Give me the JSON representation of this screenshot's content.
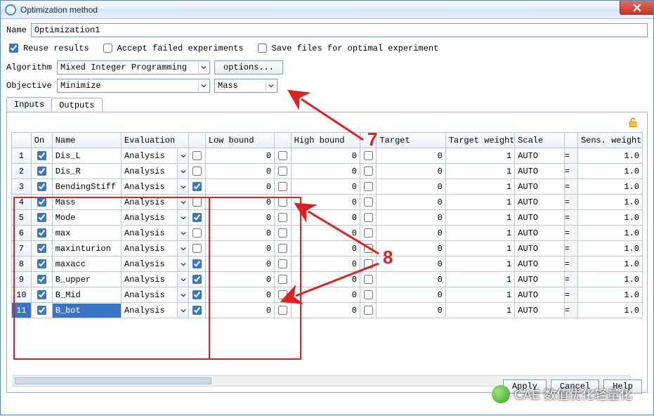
{
  "window": {
    "title": "Optimization method",
    "close_label": "X"
  },
  "fields": {
    "name_label": "Name",
    "name_value": "Optimization1",
    "reuse_label": "Reuse results",
    "reuse_checked": true,
    "accept_label": "Accept failed experiments",
    "accept_checked": false,
    "savefiles_label": "Save files for optimal experiment",
    "savefiles_checked": false,
    "algorithm_label": "Algorithm",
    "algorithm_value": "Mixed Integer Programming",
    "options_label": "options...",
    "objective_label": "Objective",
    "objective_value": "Minimize",
    "objective_target": "Mass"
  },
  "tabs": {
    "inputs": "Inputs",
    "outputs": "Outputs",
    "active": "outputs"
  },
  "columns": {
    "idx": "",
    "on": "On",
    "name": "Name",
    "evaluation": "Evaluation",
    "lowbound": "Low bound",
    "highbound": "High bound",
    "target": "Target",
    "targetweight": "Target weight",
    "scale": "Scale",
    "sensweight": "Sens. weight"
  },
  "rows": [
    {
      "idx": "1",
      "on": true,
      "name": "Dis_L",
      "eval": "Analysis",
      "lb_on": false,
      "lb": "0",
      "hb_on": false,
      "hb": "0",
      "t_on": false,
      "t": "0",
      "tw": "1",
      "scale": "AUTO",
      "eq": "=",
      "sw": "1.0",
      "sel": false
    },
    {
      "idx": "2",
      "on": true,
      "name": "Dis_R",
      "eval": "Analysis",
      "lb_on": false,
      "lb": "0",
      "hb_on": false,
      "hb": "0",
      "t_on": false,
      "t": "0",
      "tw": "1",
      "scale": "AUTO",
      "eq": "=",
      "sw": "1.0",
      "sel": false
    },
    {
      "idx": "3",
      "on": true,
      "name": "BendingStiff",
      "eval": "Analysis",
      "lb_on": true,
      "lb": "0",
      "hb_on": false,
      "hb": "0",
      "t_on": false,
      "t": "0",
      "tw": "1",
      "scale": "AUTO",
      "eq": "=",
      "sw": "1.0",
      "sel": false
    },
    {
      "idx": "4",
      "on": true,
      "name": "Mass",
      "eval": "Analysis",
      "lb_on": false,
      "lb": "0",
      "hb_on": false,
      "hb": "0",
      "t_on": false,
      "t": "0",
      "tw": "1",
      "scale": "AUTO",
      "eq": "=",
      "sw": "1.0",
      "sel": false
    },
    {
      "idx": "5",
      "on": true,
      "name": "Mode",
      "eval": "Analysis",
      "lb_on": true,
      "lb": "0",
      "hb_on": false,
      "hb": "0",
      "t_on": false,
      "t": "0",
      "tw": "1",
      "scale": "AUTO",
      "eq": "=",
      "sw": "1.0",
      "sel": false
    },
    {
      "idx": "6",
      "on": true,
      "name": "max",
      "eval": "Analysis",
      "lb_on": false,
      "lb": "0",
      "hb_on": false,
      "hb": "0",
      "t_on": false,
      "t": "0",
      "tw": "1",
      "scale": "AUTO",
      "eq": "=",
      "sw": "1.0",
      "sel": false
    },
    {
      "idx": "7",
      "on": true,
      "name": "maxinturion",
      "eval": "Analysis",
      "lb_on": false,
      "lb": "0",
      "hb_on": false,
      "hb": "0",
      "t_on": false,
      "t": "0",
      "tw": "1",
      "scale": "AUTO",
      "eq": "=",
      "sw": "1.0",
      "sel": false
    },
    {
      "idx": "8",
      "on": true,
      "name": "maxacc",
      "eval": "Analysis",
      "lb_on": true,
      "lb": "0",
      "hb_on": false,
      "hb": "0",
      "t_on": false,
      "t": "0",
      "tw": "1",
      "scale": "AUTO",
      "eq": "=",
      "sw": "1.0",
      "sel": false
    },
    {
      "idx": "9",
      "on": true,
      "name": "B_upper",
      "eval": "Analysis",
      "lb_on": true,
      "lb": "0",
      "hb_on": false,
      "hb": "0",
      "t_on": false,
      "t": "0",
      "tw": "1",
      "scale": "AUTO",
      "eq": "=",
      "sw": "1.0",
      "sel": false
    },
    {
      "idx": "10",
      "on": true,
      "name": "B_Mid",
      "eval": "Analysis",
      "lb_on": true,
      "lb": "0",
      "hb_on": false,
      "hb": "0",
      "t_on": false,
      "t": "0",
      "tw": "1",
      "scale": "AUTO",
      "eq": "=",
      "sw": "1.0",
      "sel": false
    },
    {
      "idx": "11",
      "on": true,
      "name": "B_bot",
      "eval": "Analysis",
      "lb_on": true,
      "lb": "0",
      "hb_on": false,
      "hb": "0",
      "t_on": false,
      "t": "0",
      "tw": "1",
      "scale": "AUTO",
      "eq": "=",
      "sw": "1.0",
      "sel": true
    }
  ],
  "footer": {
    "apply": "Apply",
    "cancel": "Cancel",
    "help": "Help"
  },
  "annotations": {
    "num7": "7",
    "num8": "8"
  },
  "watermark": "CAE 数值优化轻量化"
}
